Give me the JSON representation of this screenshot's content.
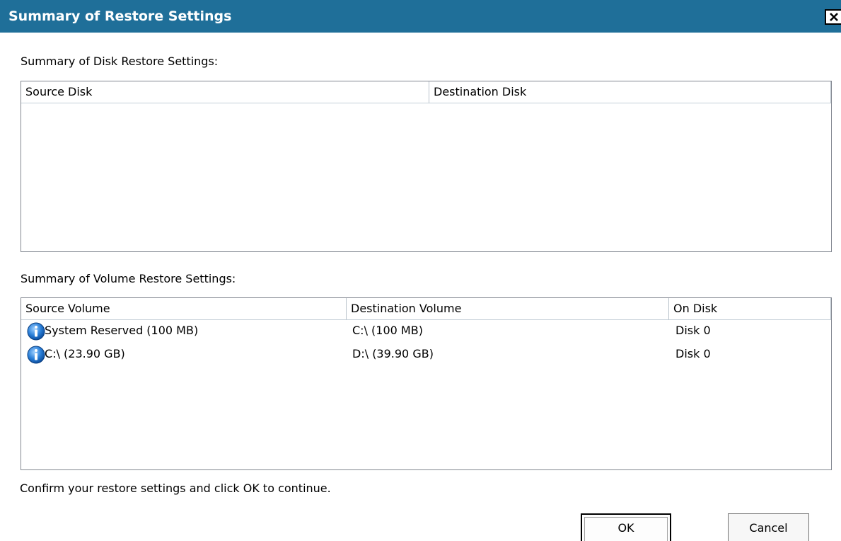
{
  "window": {
    "title": "Summary of Restore Settings",
    "close_glyph": "✕",
    "titlebar_color": "#1f6f99"
  },
  "disk_section": {
    "label": "Summary of Disk Restore Settings:",
    "columns": [
      "Source Disk",
      "Destination Disk"
    ],
    "rows": []
  },
  "volume_section": {
    "label": "Summary of Volume Restore Settings:",
    "columns": [
      "Source Volume",
      "Destination Volume",
      "On Disk"
    ],
    "rows": [
      {
        "icon": "info-icon",
        "source": "System Reserved (100 MB)",
        "destination": "C:\\ (100 MB)",
        "on_disk": "Disk 0"
      },
      {
        "icon": "info-icon",
        "source": "C:\\ (23.90 GB)",
        "destination": "D:\\ (39.90 GB)",
        "on_disk": "Disk 0"
      }
    ]
  },
  "footer": {
    "message": "Confirm your restore settings and click OK to continue."
  },
  "buttons": {
    "ok_label": "OK",
    "cancel_label": "Cancel"
  }
}
